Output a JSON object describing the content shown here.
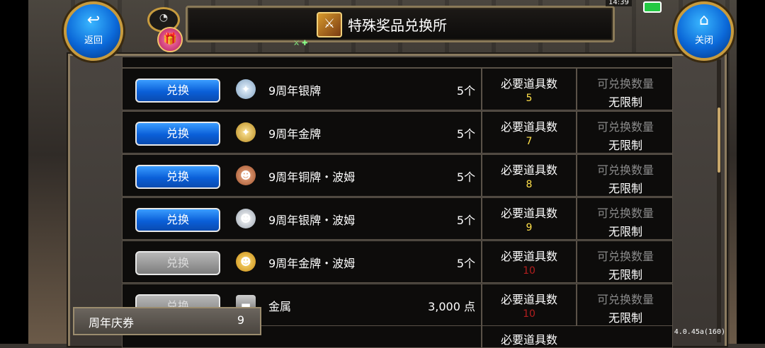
{
  "header": {
    "title": "特殊奖品兑换所"
  },
  "nav": {
    "back_label": "返回",
    "close_label": "关闭"
  },
  "status": {
    "time": "14:39"
  },
  "exchange_label_on": "兑换",
  "exchange_label_off": "兑换",
  "required_label": "必要道具数",
  "limit_label": "可兑换数量",
  "unlimited": "无限制",
  "rows": [
    {
      "name": "9周年银牌",
      "qty": "5个",
      "required": "5",
      "enabled": true,
      "icon": "silver-medal-icon"
    },
    {
      "name": "9周年金牌",
      "qty": "5个",
      "required": "7",
      "enabled": true,
      "icon": "gold-medal-icon"
    },
    {
      "name": "9周年铜牌・波姆",
      "qty": "5个",
      "required": "8",
      "enabled": true,
      "icon": "bronze-bom-medal-icon"
    },
    {
      "name": "9周年银牌・波姆",
      "qty": "5个",
      "required": "9",
      "enabled": true,
      "icon": "silver-bom-medal-icon"
    },
    {
      "name": "9周年金牌・波姆",
      "qty": "5个",
      "required": "10",
      "enabled": false,
      "icon": "gold-bom-medal-icon"
    },
    {
      "name": "金属",
      "qty": "3,000 点",
      "required": "10",
      "enabled": false,
      "icon": "metal-ingot-icon"
    }
  ],
  "ticket": {
    "label": "周年庆券",
    "value": "9"
  },
  "version": "4.0.45a(160)"
}
